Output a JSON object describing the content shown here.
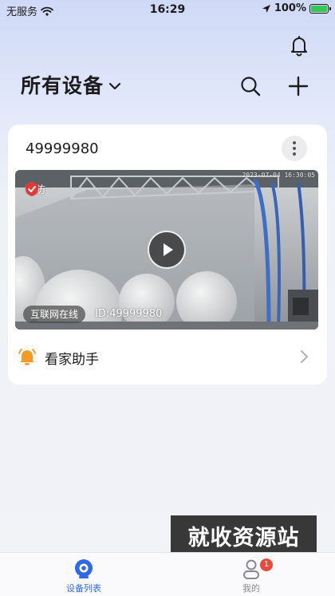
{
  "status_bar": {
    "carrier": "无服务",
    "time": "16:29",
    "battery": "100%",
    "battery_level": 1.0,
    "icons": [
      "wifi-icon",
      "location-icon",
      "battery-icon"
    ]
  },
  "header": {
    "title": "所有设备",
    "icons": [
      "bell-icon",
      "chevron-down-icon",
      "search-icon",
      "plus-icon"
    ]
  },
  "device": {
    "name": "49999980",
    "arm_label": "布防",
    "timestamp": "2023-07-04 16:30:05",
    "network_status": "互联网在线",
    "id_label": "ID:49999980",
    "icons": [
      "more-icon",
      "shield-check-icon",
      "play-icon"
    ]
  },
  "assistant": {
    "label": "看家助手",
    "icons": [
      "alarm-bell-icon",
      "chevron-right-icon"
    ]
  },
  "watermark": "就收资源站",
  "tabbar": {
    "tabs": [
      {
        "label": "设备列表",
        "icon": "devices-tab-icon",
        "active": true
      },
      {
        "label": "我的",
        "icon": "profile-tab-icon",
        "active": false
      }
    ],
    "badge": "1"
  },
  "colors": {
    "accent": "#2f68e8",
    "alert_orange": "#f59a23",
    "badge_red": "#e84b3c"
  }
}
